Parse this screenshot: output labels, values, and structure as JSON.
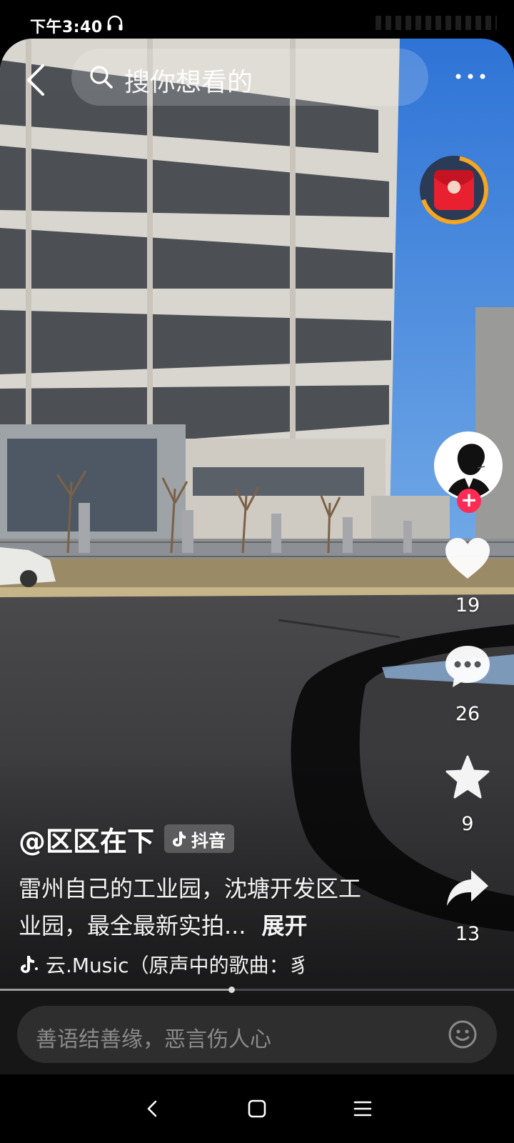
{
  "status_bar": {
    "time": "下午3:40"
  },
  "top_bar": {
    "search_placeholder": "搜你想看的"
  },
  "author": {
    "name": "@区区在下",
    "badge": "抖音"
  },
  "description": {
    "text": "雷州自己的工业园，沈塘开发区工业园，最全最新实拍...",
    "expand": "展开"
  },
  "music": {
    "text": "云.Music（原声中的歌曲：豸"
  },
  "actions": {
    "likes": "19",
    "comments": "26",
    "favorites": "9",
    "shares": "13"
  },
  "playback": {
    "progress_fraction": 0.45
  },
  "comment": {
    "placeholder": "善语结善缘，恶言伤人心"
  },
  "icons": {
    "back": "chevron-left-icon",
    "search": "search-icon",
    "more": "more-dots-icon",
    "red_packet": "red-packet-icon",
    "like": "heart-icon",
    "comment": "comment-bubble-icon",
    "favorite": "star-icon",
    "share": "share-arrow-icon",
    "music": "music-note-icon",
    "emoji": "emoji-icon",
    "nav_back": "nav-back-icon",
    "nav_home": "nav-home-icon",
    "nav_menu": "nav-menu-icon"
  },
  "colors": {
    "follow_accent": "#fe2c55",
    "red_packet_ring": "#f5a623"
  }
}
